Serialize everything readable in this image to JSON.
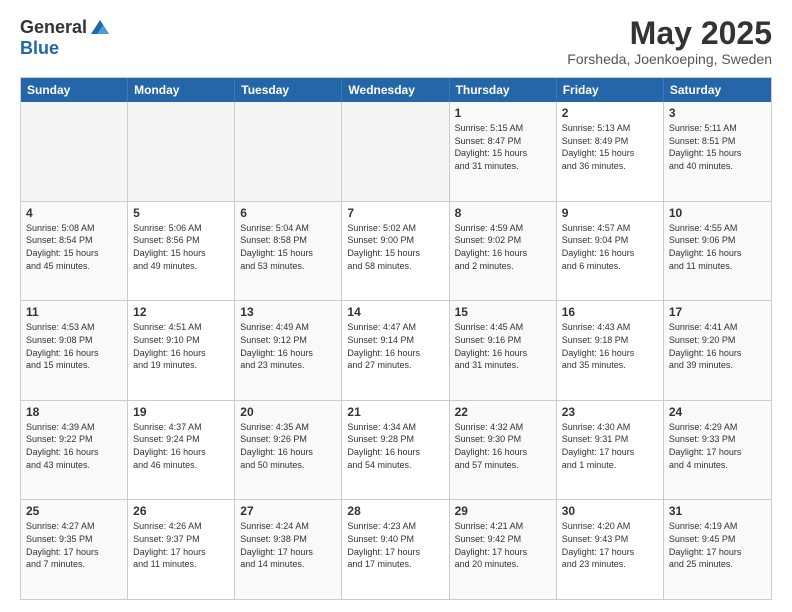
{
  "header": {
    "logo_general": "General",
    "logo_blue": "Blue",
    "month_title": "May 2025",
    "location": "Forsheda, Joenkoeping, Sweden"
  },
  "days_of_week": [
    "Sunday",
    "Monday",
    "Tuesday",
    "Wednesday",
    "Thursday",
    "Friday",
    "Saturday"
  ],
  "rows": [
    [
      {
        "day": "",
        "text": "",
        "empty": true
      },
      {
        "day": "",
        "text": "",
        "empty": true
      },
      {
        "day": "",
        "text": "",
        "empty": true
      },
      {
        "day": "",
        "text": "",
        "empty": true
      },
      {
        "day": "1",
        "text": "Sunrise: 5:15 AM\nSunset: 8:47 PM\nDaylight: 15 hours\nand 31 minutes."
      },
      {
        "day": "2",
        "text": "Sunrise: 5:13 AM\nSunset: 8:49 PM\nDaylight: 15 hours\nand 36 minutes."
      },
      {
        "day": "3",
        "text": "Sunrise: 5:11 AM\nSunset: 8:51 PM\nDaylight: 15 hours\nand 40 minutes."
      }
    ],
    [
      {
        "day": "4",
        "text": "Sunrise: 5:08 AM\nSunset: 8:54 PM\nDaylight: 15 hours\nand 45 minutes."
      },
      {
        "day": "5",
        "text": "Sunrise: 5:06 AM\nSunset: 8:56 PM\nDaylight: 15 hours\nand 49 minutes."
      },
      {
        "day": "6",
        "text": "Sunrise: 5:04 AM\nSunset: 8:58 PM\nDaylight: 15 hours\nand 53 minutes."
      },
      {
        "day": "7",
        "text": "Sunrise: 5:02 AM\nSunset: 9:00 PM\nDaylight: 15 hours\nand 58 minutes."
      },
      {
        "day": "8",
        "text": "Sunrise: 4:59 AM\nSunset: 9:02 PM\nDaylight: 16 hours\nand 2 minutes."
      },
      {
        "day": "9",
        "text": "Sunrise: 4:57 AM\nSunset: 9:04 PM\nDaylight: 16 hours\nand 6 minutes."
      },
      {
        "day": "10",
        "text": "Sunrise: 4:55 AM\nSunset: 9:06 PM\nDaylight: 16 hours\nand 11 minutes."
      }
    ],
    [
      {
        "day": "11",
        "text": "Sunrise: 4:53 AM\nSunset: 9:08 PM\nDaylight: 16 hours\nand 15 minutes."
      },
      {
        "day": "12",
        "text": "Sunrise: 4:51 AM\nSunset: 9:10 PM\nDaylight: 16 hours\nand 19 minutes."
      },
      {
        "day": "13",
        "text": "Sunrise: 4:49 AM\nSunset: 9:12 PM\nDaylight: 16 hours\nand 23 minutes."
      },
      {
        "day": "14",
        "text": "Sunrise: 4:47 AM\nSunset: 9:14 PM\nDaylight: 16 hours\nand 27 minutes."
      },
      {
        "day": "15",
        "text": "Sunrise: 4:45 AM\nSunset: 9:16 PM\nDaylight: 16 hours\nand 31 minutes."
      },
      {
        "day": "16",
        "text": "Sunrise: 4:43 AM\nSunset: 9:18 PM\nDaylight: 16 hours\nand 35 minutes."
      },
      {
        "day": "17",
        "text": "Sunrise: 4:41 AM\nSunset: 9:20 PM\nDaylight: 16 hours\nand 39 minutes."
      }
    ],
    [
      {
        "day": "18",
        "text": "Sunrise: 4:39 AM\nSunset: 9:22 PM\nDaylight: 16 hours\nand 43 minutes."
      },
      {
        "day": "19",
        "text": "Sunrise: 4:37 AM\nSunset: 9:24 PM\nDaylight: 16 hours\nand 46 minutes."
      },
      {
        "day": "20",
        "text": "Sunrise: 4:35 AM\nSunset: 9:26 PM\nDaylight: 16 hours\nand 50 minutes."
      },
      {
        "day": "21",
        "text": "Sunrise: 4:34 AM\nSunset: 9:28 PM\nDaylight: 16 hours\nand 54 minutes."
      },
      {
        "day": "22",
        "text": "Sunrise: 4:32 AM\nSunset: 9:30 PM\nDaylight: 16 hours\nand 57 minutes."
      },
      {
        "day": "23",
        "text": "Sunrise: 4:30 AM\nSunset: 9:31 PM\nDaylight: 17 hours\nand 1 minute."
      },
      {
        "day": "24",
        "text": "Sunrise: 4:29 AM\nSunset: 9:33 PM\nDaylight: 17 hours\nand 4 minutes."
      }
    ],
    [
      {
        "day": "25",
        "text": "Sunrise: 4:27 AM\nSunset: 9:35 PM\nDaylight: 17 hours\nand 7 minutes."
      },
      {
        "day": "26",
        "text": "Sunrise: 4:26 AM\nSunset: 9:37 PM\nDaylight: 17 hours\nand 11 minutes."
      },
      {
        "day": "27",
        "text": "Sunrise: 4:24 AM\nSunset: 9:38 PM\nDaylight: 17 hours\nand 14 minutes."
      },
      {
        "day": "28",
        "text": "Sunrise: 4:23 AM\nSunset: 9:40 PM\nDaylight: 17 hours\nand 17 minutes."
      },
      {
        "day": "29",
        "text": "Sunrise: 4:21 AM\nSunset: 9:42 PM\nDaylight: 17 hours\nand 20 minutes."
      },
      {
        "day": "30",
        "text": "Sunrise: 4:20 AM\nSunset: 9:43 PM\nDaylight: 17 hours\nand 23 minutes."
      },
      {
        "day": "31",
        "text": "Sunrise: 4:19 AM\nSunset: 9:45 PM\nDaylight: 17 hours\nand 25 minutes."
      }
    ]
  ]
}
